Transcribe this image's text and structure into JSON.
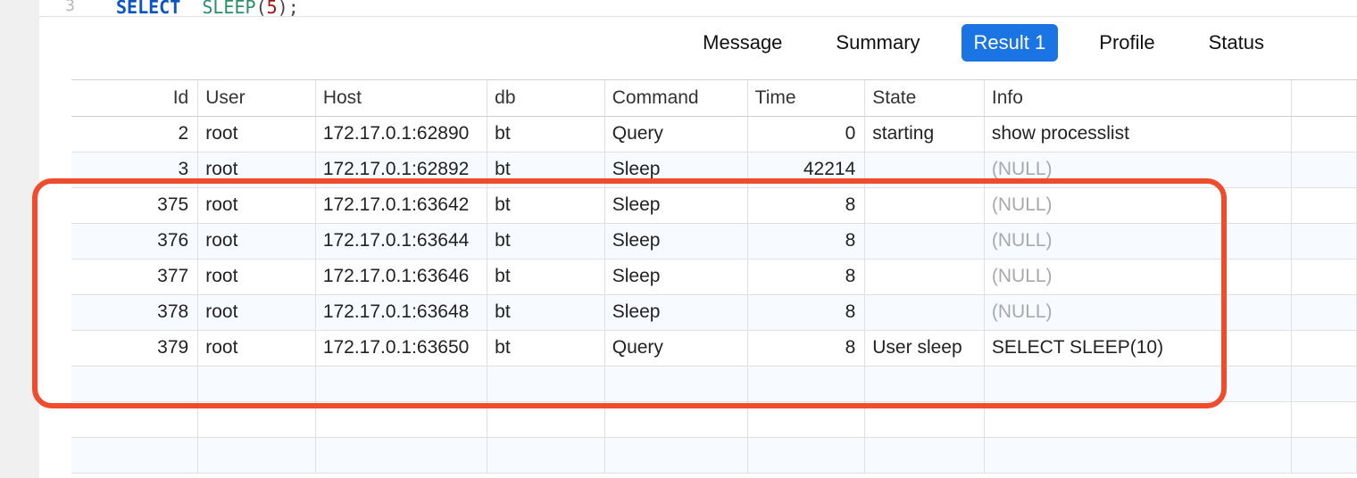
{
  "editor": {
    "line_number": "3",
    "kw_select": "SELECT",
    "fn_sleep": "SLEEP",
    "paren_open": "(",
    "arg": "5",
    "paren_close": ")",
    "semi": ";"
  },
  "tabs": {
    "message": "Message",
    "summary": "Summary",
    "result1": "Result 1",
    "profile": "Profile",
    "status": "Status"
  },
  "columns": [
    "Id",
    "User",
    "Host",
    "db",
    "Command",
    "Time",
    "State",
    "Info"
  ],
  "null_label": "(NULL)",
  "rows": [
    {
      "id": "2",
      "user": "root",
      "host": "172.17.0.1:62890",
      "db": "bt",
      "command": "Query",
      "time": "0",
      "state": "starting",
      "info": "show processlist",
      "info_null": false
    },
    {
      "id": "3",
      "user": "root",
      "host": "172.17.0.1:62892",
      "db": "bt",
      "command": "Sleep",
      "time": "42214",
      "state": "",
      "info": "",
      "info_null": true
    },
    {
      "id": "375",
      "user": "root",
      "host": "172.17.0.1:63642",
      "db": "bt",
      "command": "Sleep",
      "time": "8",
      "state": "",
      "info": "",
      "info_null": true
    },
    {
      "id": "376",
      "user": "root",
      "host": "172.17.0.1:63644",
      "db": "bt",
      "command": "Sleep",
      "time": "8",
      "state": "",
      "info": "",
      "info_null": true
    },
    {
      "id": "377",
      "user": "root",
      "host": "172.17.0.1:63646",
      "db": "bt",
      "command": "Sleep",
      "time": "8",
      "state": "",
      "info": "",
      "info_null": true
    },
    {
      "id": "378",
      "user": "root",
      "host": "172.17.0.1:63648",
      "db": "bt",
      "command": "Sleep",
      "time": "8",
      "state": "",
      "info": "",
      "info_null": true
    },
    {
      "id": "379",
      "user": "root",
      "host": "172.17.0.1:63650",
      "db": "bt",
      "command": "Query",
      "time": "8",
      "state": "User sleep",
      "info": "SELECT SLEEP(10)",
      "info_null": false
    }
  ]
}
